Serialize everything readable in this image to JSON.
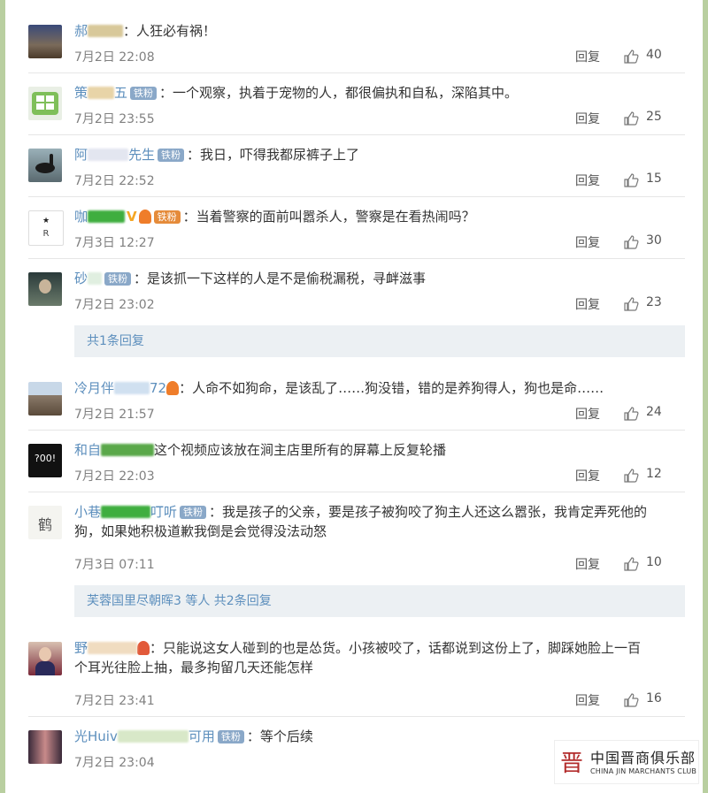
{
  "comments": [
    {
      "name_start": "郝",
      "name_end": "",
      "badge": "",
      "content": "：人狂必有祸！",
      "time": "7月2日 22:08",
      "reply": "回复",
      "likes": "40"
    },
    {
      "name_start": "策",
      "name_end": "五",
      "badge": "铁粉",
      "content": "：一个观察，执着于宠物的人，都很偏执和自私，深陷其中。",
      "time": "7月2日 23:55",
      "reply": "回复",
      "likes": "25"
    },
    {
      "name_start": "阿",
      "name_end": "先生",
      "badge": "铁粉",
      "content": "：我日，吓得我都尿裤子上了",
      "time": "7月2日 22:52",
      "reply": "回复",
      "likes": "15"
    },
    {
      "name_start": "咖",
      "name_end": "",
      "verified": "V",
      "badge": "铁粉",
      "content": "：当着警察的面前叫嚣杀人，警察是在看热闹吗？",
      "time": "7月3日 12:27",
      "reply": "回复",
      "likes": "30"
    },
    {
      "name_start": "砂",
      "name_end": "",
      "badge": "铁粉",
      "content": "：是该抓一下这样的人是不是偷税漏税，寻衅滋事",
      "time": "7月2日 23:02",
      "reply": "回复",
      "likes": "23"
    },
    {
      "name_start": "冷月伴",
      "name_end": "72",
      "badge": "",
      "content": "：人命不如狗命，是该乱了……狗没错，错的是养狗得人，狗也是命……",
      "time": "7月2日 21:57",
      "reply": "回复",
      "likes": "24"
    },
    {
      "name_start": "和自",
      "name_end": "",
      "badge": "",
      "content": "这个视频应该放在涧主店里所有的屏幕上反复轮播",
      "time": "7月2日 22:03",
      "reply": "回复",
      "likes": "12"
    },
    {
      "name_start": "小巷",
      "name_end": "叮听",
      "badge": "铁粉",
      "content": "：我是孩子的父亲，要是孩子被狗咬了狗主人还这么嚣张，我肯定弄死他的",
      "content2": "狗，如果她积极道歉我倒是会觉得没法动怒",
      "time": "7月3日 07:11",
      "reply": "回复",
      "likes": "10"
    },
    {
      "name_start": "野",
      "name_end": "",
      "badge": "",
      "content": "：只能说这女人碰到的也是怂货。小孩被咬了，话都说到这份上了，脚踩她脸上一百",
      "content2": "个耳光往脸上抽，最多拘留几天还能怎样",
      "time": "7月2日 23:41",
      "reply": "回复",
      "likes": "16"
    },
    {
      "name_start": "光Huiv",
      "name_end": "可用",
      "badge": "铁粉",
      "content": "：等个后续",
      "time": "7月2日 23:04",
      "reply": "回复",
      "likes": ""
    }
  ],
  "reply_boxes": [
    {
      "text": "共1条回复"
    },
    {
      "text": "芙蓉国里尽朝晖3 等人 共2条回复"
    }
  ],
  "watermark": {
    "logo": "晋",
    "cn": "中国晋商俱乐部",
    "en": "CHINA JIN MARCHANTS CLUB"
  },
  "colors": {
    "accent": "#5d8fbd",
    "frame": "#b9cfa0",
    "reply_bg": "#ecf0f3"
  }
}
